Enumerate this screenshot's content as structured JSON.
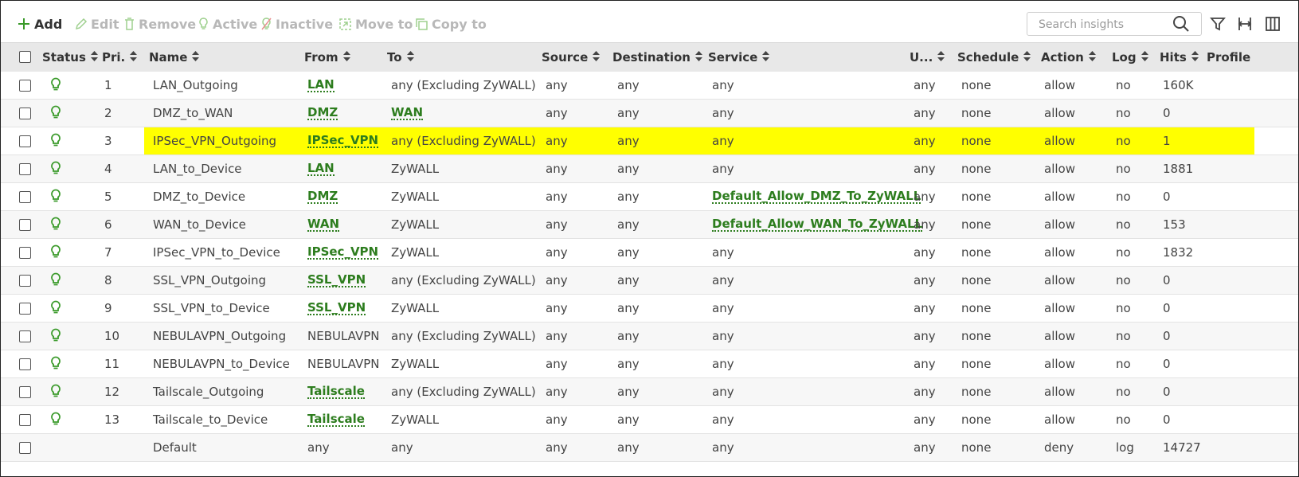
{
  "toolbar": {
    "add": "Add",
    "edit": "Edit",
    "remove": "Remove",
    "active": "Active",
    "inactive": "Inactive",
    "move_to": "Move to",
    "copy_to": "Copy to",
    "search_placeholder": "Search insights",
    "accent_color": "#3a9a2a",
    "disabled_color": "#b8b8b8"
  },
  "columns": [
    "Status",
    "Pri.",
    "Name",
    "From",
    "To",
    "Source",
    "Destination",
    "Service",
    "U...",
    "Schedule",
    "Action",
    "Log",
    "Hits",
    "Profile"
  ],
  "rows": [
    {
      "pri": "1",
      "name": "LAN_Outgoing",
      "from": "LAN",
      "from_link": true,
      "to": "any (Excluding ZyWALL)",
      "to_link": false,
      "source": "any",
      "destination": "any",
      "service": "any",
      "service_link": false,
      "user": "any",
      "schedule": "none",
      "action": "allow",
      "log": "no",
      "hits": "160K",
      "status": true,
      "highlight": false
    },
    {
      "pri": "2",
      "name": "DMZ_to_WAN",
      "from": "DMZ",
      "from_link": true,
      "to": "WAN",
      "to_link": true,
      "source": "any",
      "destination": "any",
      "service": "any",
      "service_link": false,
      "user": "any",
      "schedule": "none",
      "action": "allow",
      "log": "no",
      "hits": "0",
      "status": true,
      "highlight": false
    },
    {
      "pri": "3",
      "name": "IPSec_VPN_Outgoing",
      "from": "IPSec_VPN",
      "from_link": true,
      "to": "any (Excluding ZyWALL)",
      "to_link": false,
      "source": "any",
      "destination": "any",
      "service": "any",
      "service_link": false,
      "user": "any",
      "schedule": "none",
      "action": "allow",
      "log": "no",
      "hits": "1",
      "status": true,
      "highlight": true
    },
    {
      "pri": "4",
      "name": "LAN_to_Device",
      "from": "LAN",
      "from_link": true,
      "to": "ZyWALL",
      "to_link": false,
      "source": "any",
      "destination": "any",
      "service": "any",
      "service_link": false,
      "user": "any",
      "schedule": "none",
      "action": "allow",
      "log": "no",
      "hits": "1881",
      "status": true,
      "highlight": false
    },
    {
      "pri": "5",
      "name": "DMZ_to_Device",
      "from": "DMZ",
      "from_link": true,
      "to": "ZyWALL",
      "to_link": false,
      "source": "any",
      "destination": "any",
      "service": "Default_Allow_DMZ_To_ZyWALL",
      "service_link": true,
      "user": "any",
      "schedule": "none",
      "action": "allow",
      "log": "no",
      "hits": "0",
      "status": true,
      "highlight": false
    },
    {
      "pri": "6",
      "name": "WAN_to_Device",
      "from": "WAN",
      "from_link": true,
      "to": "ZyWALL",
      "to_link": false,
      "source": "any",
      "destination": "any",
      "service": "Default_Allow_WAN_To_ZyWALL",
      "service_link": true,
      "user": "any",
      "schedule": "none",
      "action": "allow",
      "log": "no",
      "hits": "153",
      "status": true,
      "highlight": false
    },
    {
      "pri": "7",
      "name": "IPSec_VPN_to_Device",
      "from": "IPSec_VPN",
      "from_link": true,
      "to": "ZyWALL",
      "to_link": false,
      "source": "any",
      "destination": "any",
      "service": "any",
      "service_link": false,
      "user": "any",
      "schedule": "none",
      "action": "allow",
      "log": "no",
      "hits": "1832",
      "status": true,
      "highlight": false
    },
    {
      "pri": "8",
      "name": "SSL_VPN_Outgoing",
      "from": "SSL_VPN",
      "from_link": true,
      "to": "any (Excluding ZyWALL)",
      "to_link": false,
      "source": "any",
      "destination": "any",
      "service": "any",
      "service_link": false,
      "user": "any",
      "schedule": "none",
      "action": "allow",
      "log": "no",
      "hits": "0",
      "status": true,
      "highlight": false
    },
    {
      "pri": "9",
      "name": "SSL_VPN_to_Device",
      "from": "SSL_VPN",
      "from_link": true,
      "to": "ZyWALL",
      "to_link": false,
      "source": "any",
      "destination": "any",
      "service": "any",
      "service_link": false,
      "user": "any",
      "schedule": "none",
      "action": "allow",
      "log": "no",
      "hits": "0",
      "status": true,
      "highlight": false
    },
    {
      "pri": "10",
      "name": "NEBULAVPN_Outgoing",
      "from": "NEBULAVPN",
      "from_link": false,
      "to": "any (Excluding ZyWALL)",
      "to_link": false,
      "source": "any",
      "destination": "any",
      "service": "any",
      "service_link": false,
      "user": "any",
      "schedule": "none",
      "action": "allow",
      "log": "no",
      "hits": "0",
      "status": true,
      "highlight": false
    },
    {
      "pri": "11",
      "name": "NEBULAVPN_to_Device",
      "from": "NEBULAVPN",
      "from_link": false,
      "to": "ZyWALL",
      "to_link": false,
      "source": "any",
      "destination": "any",
      "service": "any",
      "service_link": false,
      "user": "any",
      "schedule": "none",
      "action": "allow",
      "log": "no",
      "hits": "0",
      "status": true,
      "highlight": false
    },
    {
      "pri": "12",
      "name": "Tailscale_Outgoing",
      "from": "Tailscale",
      "from_link": true,
      "to": "any (Excluding ZyWALL)",
      "to_link": false,
      "source": "any",
      "destination": "any",
      "service": "any",
      "service_link": false,
      "user": "any",
      "schedule": "none",
      "action": "allow",
      "log": "no",
      "hits": "0",
      "status": true,
      "highlight": false
    },
    {
      "pri": "13",
      "name": "Tailscale_to_Device",
      "from": "Tailscale",
      "from_link": true,
      "to": "ZyWALL",
      "to_link": false,
      "source": "any",
      "destination": "any",
      "service": "any",
      "service_link": false,
      "user": "any",
      "schedule": "none",
      "action": "allow",
      "log": "no",
      "hits": "0",
      "status": true,
      "highlight": false
    },
    {
      "pri": "",
      "name": "Default",
      "from": "any",
      "from_link": false,
      "to": "any",
      "to_link": false,
      "source": "any",
      "destination": "any",
      "service": "any",
      "service_link": false,
      "user": "any",
      "schedule": "none",
      "action": "deny",
      "log": "log",
      "hits": "14727",
      "status": false,
      "highlight": false
    }
  ],
  "colors": {
    "highlight": "#ffff00",
    "link": "#2d7d1e",
    "status_active": "#3a9a2a",
    "header_bg": "#e8e8e8"
  }
}
